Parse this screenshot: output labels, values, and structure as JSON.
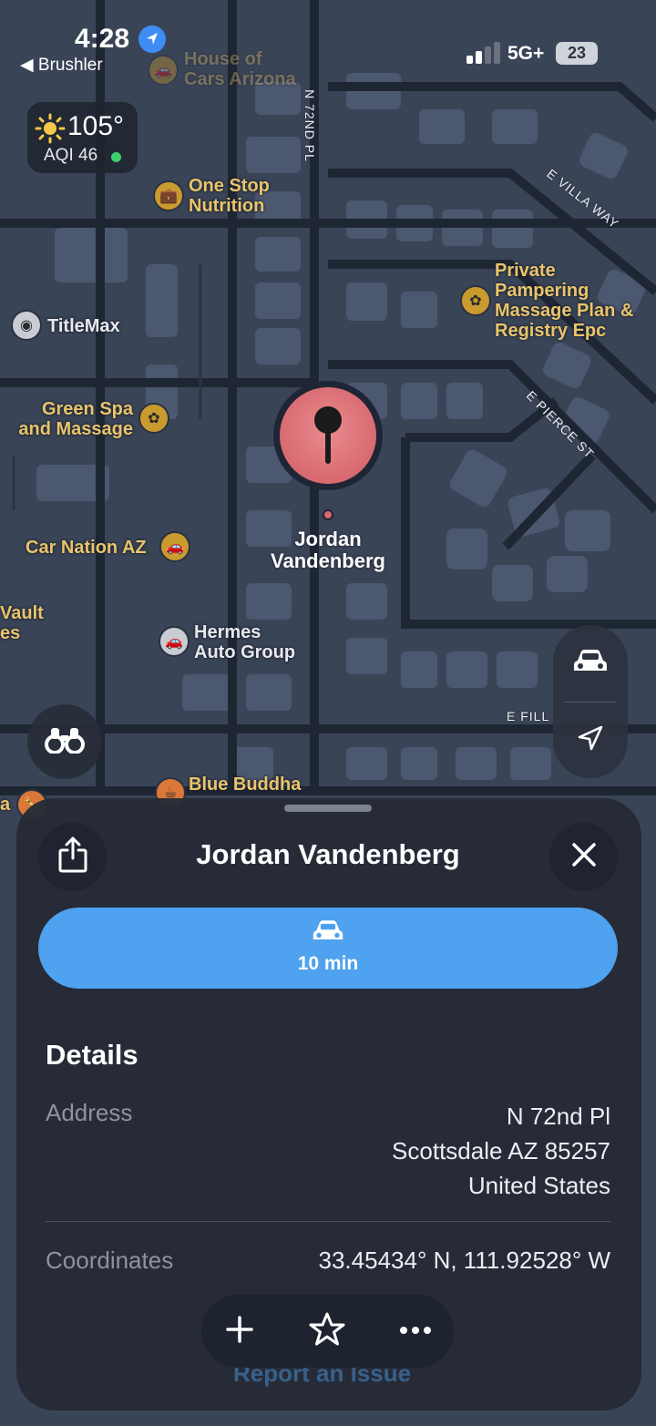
{
  "status_bar": {
    "time": "4:28",
    "back_app": "Brushler",
    "network": "5G+",
    "battery": "23"
  },
  "weather": {
    "temperature": "105°",
    "aqi": "AQI 46",
    "aqi_status_color": "#3cd070"
  },
  "map": {
    "pois": [
      {
        "name": "House of\nCars Arizona",
        "icon": "car-icon"
      },
      {
        "name": "One Stop\nNutrition",
        "icon": "briefcase-icon"
      },
      {
        "name": "Private\nPampering\nMassage Plan &\nRegistry Epc",
        "icon": "lotus-icon"
      },
      {
        "name": "TitleMax",
        "icon": "circle-dot-icon"
      },
      {
        "name": "Green Spa\nand Massage",
        "icon": "lotus-icon"
      },
      {
        "name": "Car Nation AZ",
        "icon": "car-icon"
      },
      {
        "name": "Vault\nes",
        "icon": ""
      },
      {
        "name": "Hermes\nAuto Group",
        "icon": "car-icon"
      },
      {
        "name": "Blue Buddha",
        "icon": "cup-icon"
      },
      {
        "name": "a",
        "icon": "bottle-icon"
      }
    ],
    "streets": {
      "n72": "N 72ND PL",
      "villa": "E VILLA WAY",
      "pierce": "E PIERCE ST",
      "fill": "E FILL"
    },
    "pin_label": "Jordan\nVandenberg"
  },
  "sheet": {
    "title": "Jordan Vandenberg",
    "route": {
      "icon": "car-icon",
      "eta": "10 min"
    },
    "details_heading": "Details",
    "address_label": "Address",
    "address_lines": [
      "N 72nd Pl",
      "Scottsdale AZ 85257",
      "United States"
    ],
    "coordinates_label": "Coordinates",
    "coordinates": "33.45434° N, 111.92528° W",
    "report_link": "Report an Issue"
  },
  "colors": {
    "accent": "#4ea2ef",
    "poi": "#e9c46a",
    "pin": "#d9676e"
  }
}
